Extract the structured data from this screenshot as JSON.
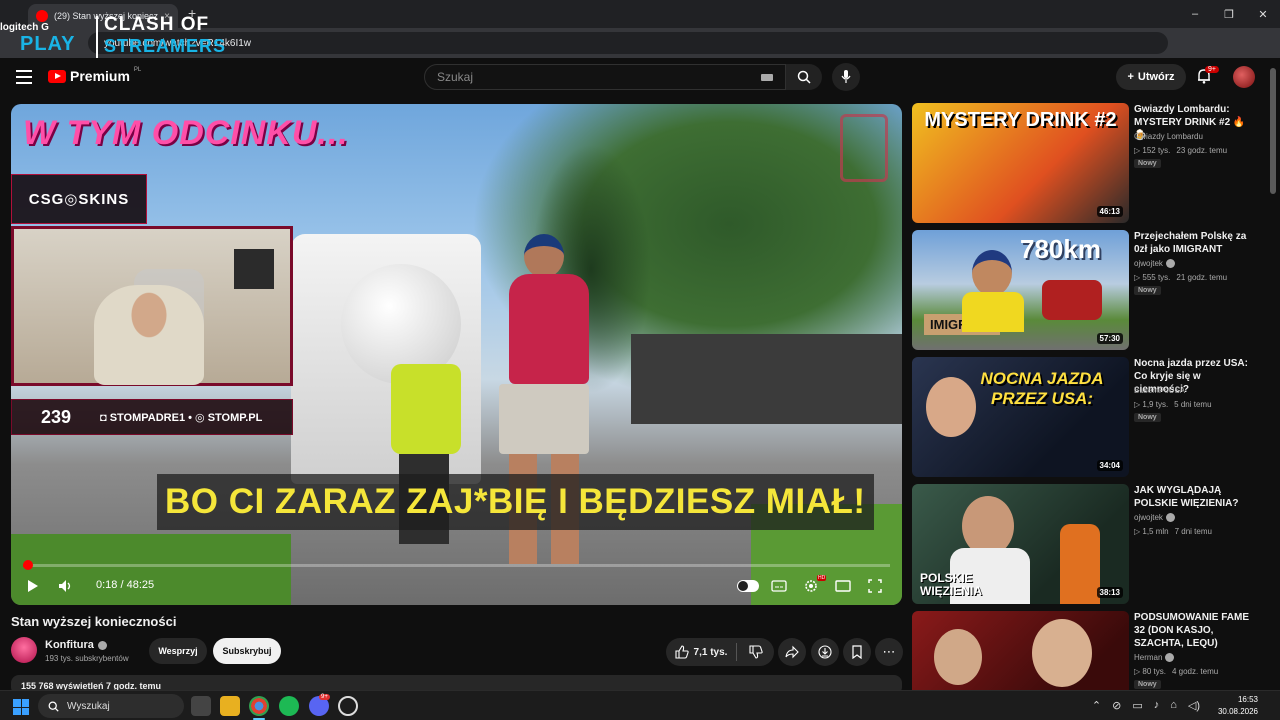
{
  "browser": {
    "tab_title": "(29) Stan wyższej konieczności",
    "tab_close": "×",
    "new_tab": "+",
    "url": "youtube.com/watch?v=R14k6I1w",
    "window_controls": [
      "–",
      "❐",
      "✕"
    ]
  },
  "overlay_logo": {
    "logitech": "logitech G",
    "play": "PLAY",
    "clash": "CLASH OF",
    "streamers": "STREAMERS"
  },
  "youtube_header": {
    "logo_text": "Premium",
    "region": "PL",
    "search_placeholder": "Szukaj",
    "create_label": "Utwórz",
    "notifications_badge": "9+"
  },
  "player": {
    "overlay_title": "W TYM ODCINKU...",
    "sponsor": "CSG◎SKINS",
    "counter": "239",
    "socials": "◘ STOMPADRE1 • ◎ STOMP.PL",
    "subtitle": "BO CI ZARAZ ZAJ*BIĘ I BĘDZIESZ MIAŁ!",
    "current_time": "0:18",
    "duration": "48:25",
    "progress_fraction": 0.0062,
    "time_separator": " / "
  },
  "video": {
    "title": "Stan wyższej konieczności",
    "channel": "Konfitura",
    "subscribers": "193 tys. subskrybentów",
    "support_label": "Wesprzyj",
    "subscribe_label": "Subskrybuj",
    "likes": "7,1 tys.",
    "description_preview": "155 768 wyświetleń  7 godz. temu"
  },
  "recommendations": [
    {
      "title": "Gwiazdy Lombardu: MYSTERY DRINK #2 🔥🍺",
      "channel": "Gwiazdy Lombardu",
      "verified": false,
      "views": "152 tys.",
      "age": "23 godz. temu",
      "badge": "Nowy",
      "duration": "46:13",
      "thumb_text": "MYSTERY DRINK #2",
      "thumb_color": "#e8c020"
    },
    {
      "title": "Przejechałem Polskę za 0zł jako IMIGRANT",
      "channel": "ojwojtek",
      "verified": true,
      "views": "555 tys.",
      "age": "21 godz. temu",
      "badge": "Nowy",
      "duration": "57:30",
      "thumb_text": "780km",
      "thumb_color": "#5a8ac8"
    },
    {
      "title": "Nocna jazda przez USA: Co kryje się w ciemności?",
      "channel": "BusemPoUSA",
      "verified": false,
      "views": "1,9 tys.",
      "age": "5 dni temu",
      "badge": "Nowy",
      "duration": "34:04",
      "thumb_text": "NOCNA JAZDA PRZEZ USA:",
      "thumb_color": "#1a2a44"
    },
    {
      "title": "JAK WYGLĄDAJĄ POLSKIE WIĘZIENIA?",
      "channel": "ojwojtek",
      "verified": true,
      "views": "1,5 mln",
      "age": "7 dni temu",
      "badge": "",
      "duration": "38:13",
      "thumb_text": "POLSKIE WIĘZIENIA",
      "thumb_color": "#2a4a3a"
    },
    {
      "title": "PODSUMOWANIE FAME 32 (DON KASJO, SZACHTA, LEQU)",
      "channel": "Herman",
      "verified": true,
      "views": "80 tys.",
      "age": "4 godz. temu",
      "badge": "Nowy",
      "duration": "",
      "thumb_text": "",
      "thumb_color": "#7a1a1a"
    }
  ],
  "taskbar": {
    "search_placeholder": "Wyszukaj",
    "time": "16:53",
    "date": "30.08.2026",
    "discord_badge": "9+"
  }
}
